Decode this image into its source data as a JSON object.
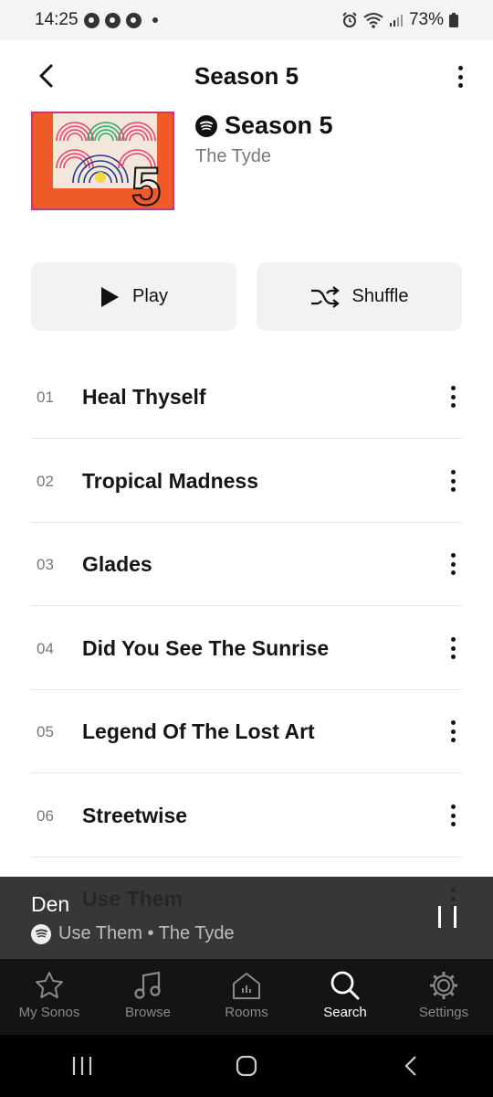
{
  "status_bar": {
    "time": "14:25",
    "battery": "73%"
  },
  "header": {
    "title": "Season 5"
  },
  "album": {
    "title": "Season 5",
    "artist": "The Tyde"
  },
  "actions": {
    "play_label": "Play",
    "shuffle_label": "Shuffle"
  },
  "tracks": [
    {
      "num": "01",
      "title": "Heal Thyself"
    },
    {
      "num": "02",
      "title": "Tropical Madness"
    },
    {
      "num": "03",
      "title": "Glades"
    },
    {
      "num": "04",
      "title": "Did You See The Sunrise"
    },
    {
      "num": "05",
      "title": "Legend Of The Lost Art"
    },
    {
      "num": "06",
      "title": "Streetwise"
    },
    {
      "num": "07",
      "title": "Use Them"
    }
  ],
  "mini_player": {
    "room": "Den",
    "now_playing": "Use Them • The Tyde"
  },
  "bottom_nav": [
    {
      "label": "My Sonos",
      "icon": "star-icon"
    },
    {
      "label": "Browse",
      "icon": "music-note-icon"
    },
    {
      "label": "Rooms",
      "icon": "house-icon"
    },
    {
      "label": "Search",
      "icon": "search-icon"
    },
    {
      "label": "Settings",
      "icon": "gear-icon"
    }
  ],
  "colors": {
    "album_background": "#f05a28",
    "album_border": "#c0387a",
    "nav_background": "#141414",
    "mini_player_background": "#282828"
  }
}
